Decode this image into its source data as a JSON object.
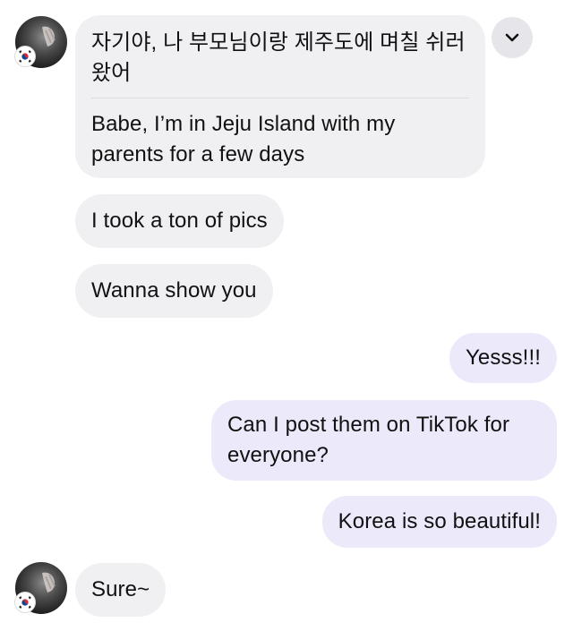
{
  "conversation": {
    "messages": [
      {
        "sender": "them",
        "text_ko": "자기야, 나 부모님이랑 제주도에 며칠 쉬러 왔어",
        "text_en": "Babe, I’m in Jeju Island with my parents for a few days"
      },
      {
        "sender": "them",
        "text": "I took a ton of pics"
      },
      {
        "sender": "them",
        "text": "Wanna show you"
      },
      {
        "sender": "me",
        "text": "Yesss!!!"
      },
      {
        "sender": "me",
        "text": "Can I post them on TikTok for everyone?"
      },
      {
        "sender": "me",
        "text": "Korea is so beautiful!"
      },
      {
        "sender": "them",
        "text": "Sure~"
      }
    ]
  },
  "colors": {
    "incoming_bubble": "#f0f0f3",
    "outgoing_bubble": "#ece9fb",
    "text": "#111111"
  },
  "icons": {
    "avatar_flag": "south-korea-flag-icon",
    "expand": "chevron-down-icon"
  }
}
